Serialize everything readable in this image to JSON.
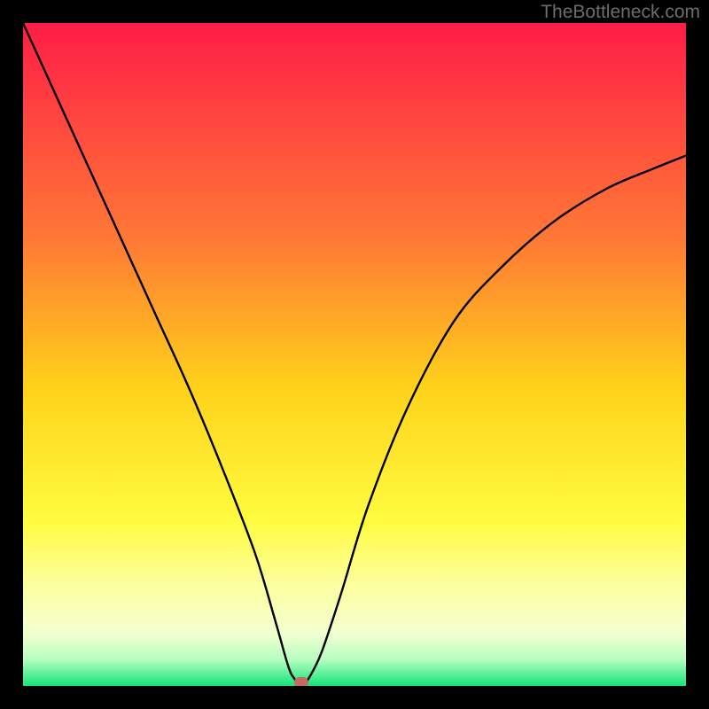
{
  "watermark": "TheBottleneck.com",
  "marker_color": "#c56a62",
  "chart_data": {
    "type": "line",
    "title": "",
    "xlabel": "",
    "ylabel": "",
    "xlim": [
      0,
      100
    ],
    "ylim": [
      0,
      100
    ],
    "grid": false,
    "legend": false,
    "background_gradient": {
      "direction": "vertical",
      "stops": [
        {
          "pos": 0.0,
          "color": "#ff1d47"
        },
        {
          "pos": 0.33,
          "color": "#ff7a35"
        },
        {
          "pos": 0.55,
          "color": "#ffd21a"
        },
        {
          "pos": 0.75,
          "color": "#fffc3f"
        },
        {
          "pos": 0.85,
          "color": "#fcffa0"
        },
        {
          "pos": 0.92,
          "color": "#f3ffd1"
        },
        {
          "pos": 0.96,
          "color": "#b7ffbf"
        },
        {
          "pos": 1.0,
          "color": "#14e37a"
        }
      ]
    },
    "series": [
      {
        "name": "bottleneck-curve",
        "color": "#000000",
        "x": [
          0,
          5,
          10,
          15,
          20,
          25,
          30,
          35,
          38,
          40,
          41,
          42,
          43,
          45,
          48,
          52,
          58,
          65,
          72,
          80,
          88,
          95,
          100
        ],
        "y": [
          100,
          89,
          78,
          67,
          56,
          45,
          33,
          20,
          10,
          3,
          1,
          0,
          1,
          5,
          14,
          27,
          42,
          55,
          63,
          70,
          75,
          78,
          80
        ]
      }
    ],
    "markers": [
      {
        "name": "optimal-point",
        "x": 42,
        "y": 0.5,
        "color": "#c56a62"
      }
    ]
  }
}
